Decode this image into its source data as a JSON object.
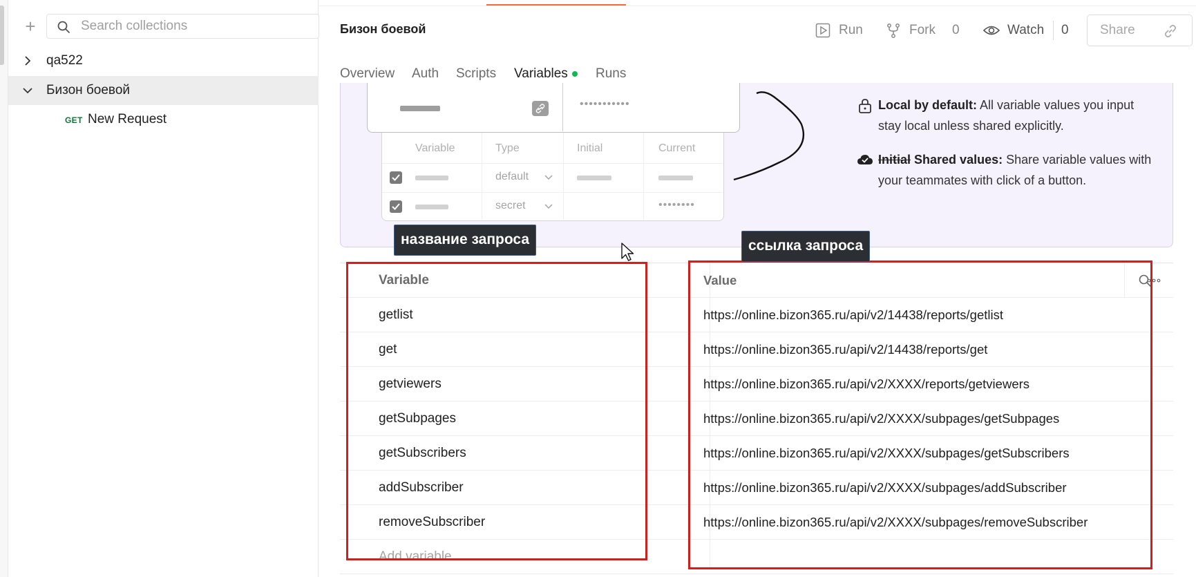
{
  "sidebar": {
    "search_placeholder": "Search collections",
    "items": [
      {
        "label": "qa522",
        "expanded": false
      },
      {
        "label": "Бизон боевой",
        "expanded": true
      }
    ],
    "request": {
      "method": "GET",
      "label": "New Request"
    }
  },
  "header": {
    "title": "Бизон боевой",
    "run_label": "Run",
    "fork_label": "Fork",
    "fork_count": "0",
    "watch_label": "Watch",
    "watch_count": "0",
    "share_label": "Share"
  },
  "tabs": [
    {
      "label": "Overview"
    },
    {
      "label": "Auth"
    },
    {
      "label": "Scripts"
    },
    {
      "label": "Variables",
      "active": true
    },
    {
      "label": "Runs"
    }
  ],
  "banner": {
    "mock_headers": [
      "Variable",
      "Type",
      "Initial",
      "Current"
    ],
    "mock_rows": [
      {
        "type": "default",
        "current_dots": ""
      },
      {
        "type": "secret",
        "current_dots": "••••••••"
      }
    ],
    "mock_top_dots": "•••••••••••",
    "feature1": {
      "title": "Local by default:",
      "text": "All variable values you input stay local unless shared explicitly."
    },
    "feature2": {
      "strike": "Initial",
      "title": "Shared values:",
      "text": "Share variable values with your teammates with click of a button."
    }
  },
  "annotations": {
    "name_tip": "название запроса",
    "link_tip": "ссылка запроса"
  },
  "variables_table": {
    "headers": {
      "variable": "Variable",
      "value": "Value"
    },
    "rows": [
      {
        "name": "getlist",
        "value": "https://online.bizon365.ru/api/v2/14438/reports/getlist"
      },
      {
        "name": "get",
        "value": "https://online.bizon365.ru/api/v2/14438/reports/get"
      },
      {
        "name": "getviewers",
        "value": "https://online.bizon365.ru/api/v2/XXXX/reports/getviewers"
      },
      {
        "name": "getSubpages",
        "value": "https://online.bizon365.ru/api/v2/XXXX/subpages/getSubpages"
      },
      {
        "name": "getSubscribers",
        "value": "https://online.bizon365.ru/api/v2/XXXX/subpages/getSubscribers"
      },
      {
        "name": "addSubscriber",
        "value": "https://online.bizon365.ru/api/v2/XXXX/subpages/addSubscriber"
      },
      {
        "name": "removeSubscriber",
        "value": "https://online.bizon365.ru/api/v2/XXXX/subpages/removeSubscriber"
      }
    ],
    "add_placeholder": "Add variable"
  },
  "colors": {
    "accent": "#f26b3a",
    "active_dot": "#0cbb52",
    "annotation_red": "#d0201e",
    "get_method": "#0c7a36",
    "banner_bg": "#f5f2fd"
  },
  "icons": [
    "plus-icon",
    "search-icon",
    "chevron-right-icon",
    "chevron-down-icon",
    "play-icon",
    "fork-icon",
    "eye-icon",
    "link-icon",
    "lock-icon",
    "cloud-check-icon",
    "more-icon",
    "cursor-icon"
  ]
}
